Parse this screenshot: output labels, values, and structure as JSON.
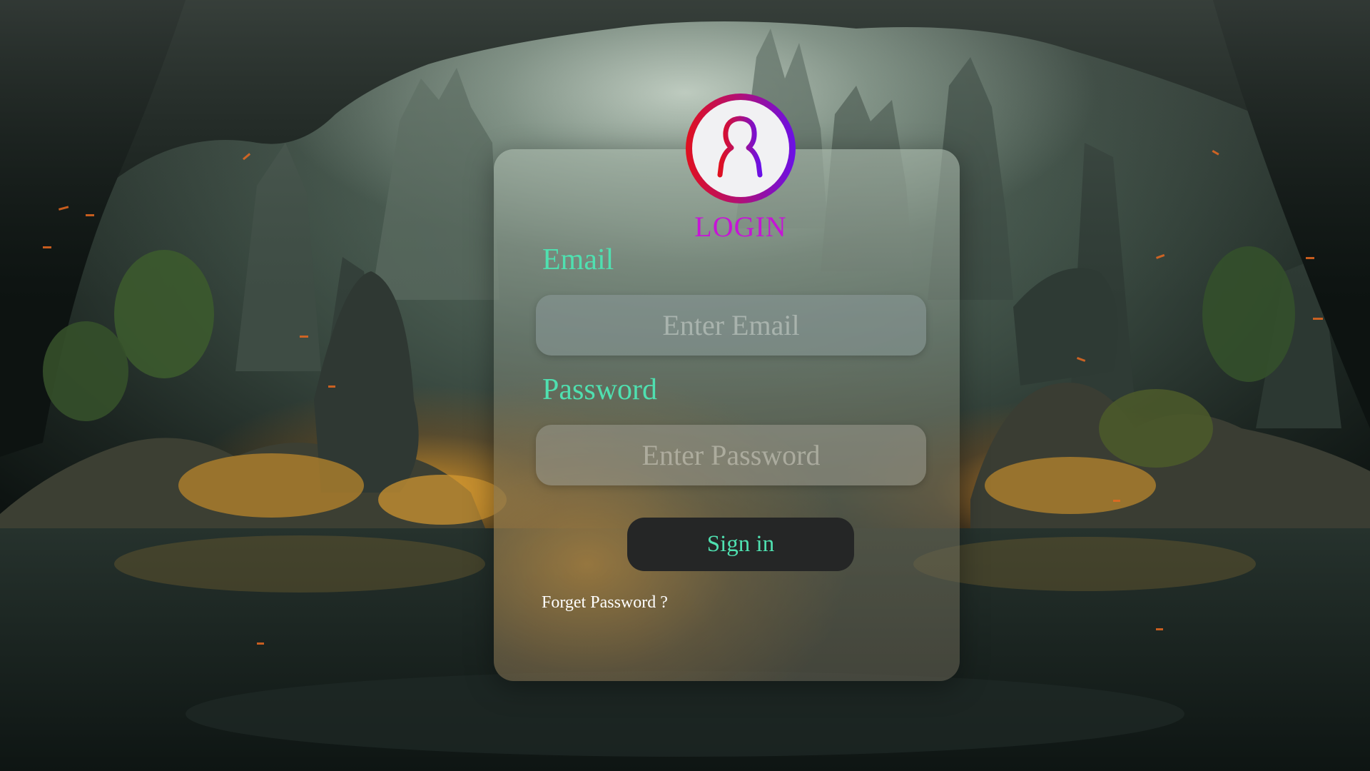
{
  "login": {
    "avatar_icon": "user-avatar-icon",
    "title": "LOGIN",
    "email_label": "Email",
    "email_placeholder": "Enter Email",
    "password_label": "Password",
    "password_placeholder": "Enter Password",
    "signin_label": "Sign in",
    "forget_label": "Forget Password ?"
  },
  "colors": {
    "label": "#4fe0b0",
    "title": "#c615d6",
    "button_bg": "#252626",
    "avatar_gradient_start": "#e0101e",
    "avatar_gradient_end": "#6a10e8"
  }
}
